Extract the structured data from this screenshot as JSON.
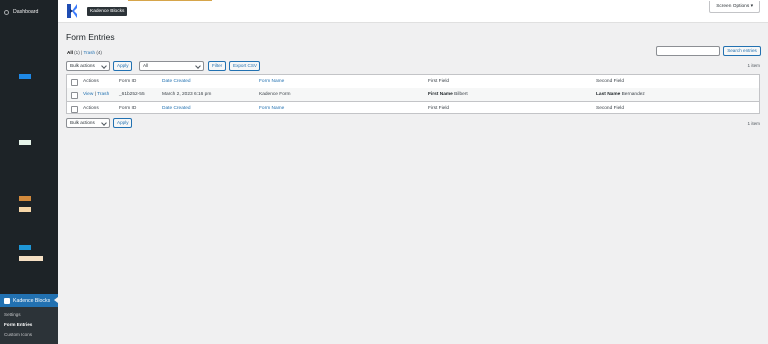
{
  "sidebar": {
    "dashboard": "Dashboard",
    "active_menu": "Kadence Blocks",
    "submenu": [
      "Settings",
      "Form Entries",
      "Custom Icons"
    ]
  },
  "header": {
    "brand": "Kadence Blocks",
    "screen_options": "Screen Options ▾"
  },
  "page": {
    "title": "Form Entries",
    "views": {
      "all": "All",
      "all_count": "(1)",
      "sep": "|",
      "trash": "Trash",
      "trash_count": "(4)"
    },
    "search_button": "Search entries",
    "bulk_select": "Bulk actions",
    "apply": "Apply",
    "form_filter": "All",
    "filter": "Filter",
    "export": "Export CSV",
    "item_count": "1 item"
  },
  "table": {
    "headers": [
      "Actions",
      "Form ID",
      "Date Created",
      "Form Name",
      "First Field",
      "Second Field"
    ],
    "row": {
      "actions_view": "View",
      "actions_sep": "|",
      "actions_trash": "Trash",
      "form_id": "_61b252-55",
      "date": "March 2, 2023 6:16 pm",
      "form_name": "Kadence Form",
      "first_field_label": "First Name",
      "first_field_value": "Bilbert",
      "second_field_label": "Last Name",
      "second_field_value": "Bernandez"
    }
  },
  "colors": {
    "sidebar": "#1d2327",
    "accent": "#2271b1",
    "background": "#f0f0f1"
  }
}
